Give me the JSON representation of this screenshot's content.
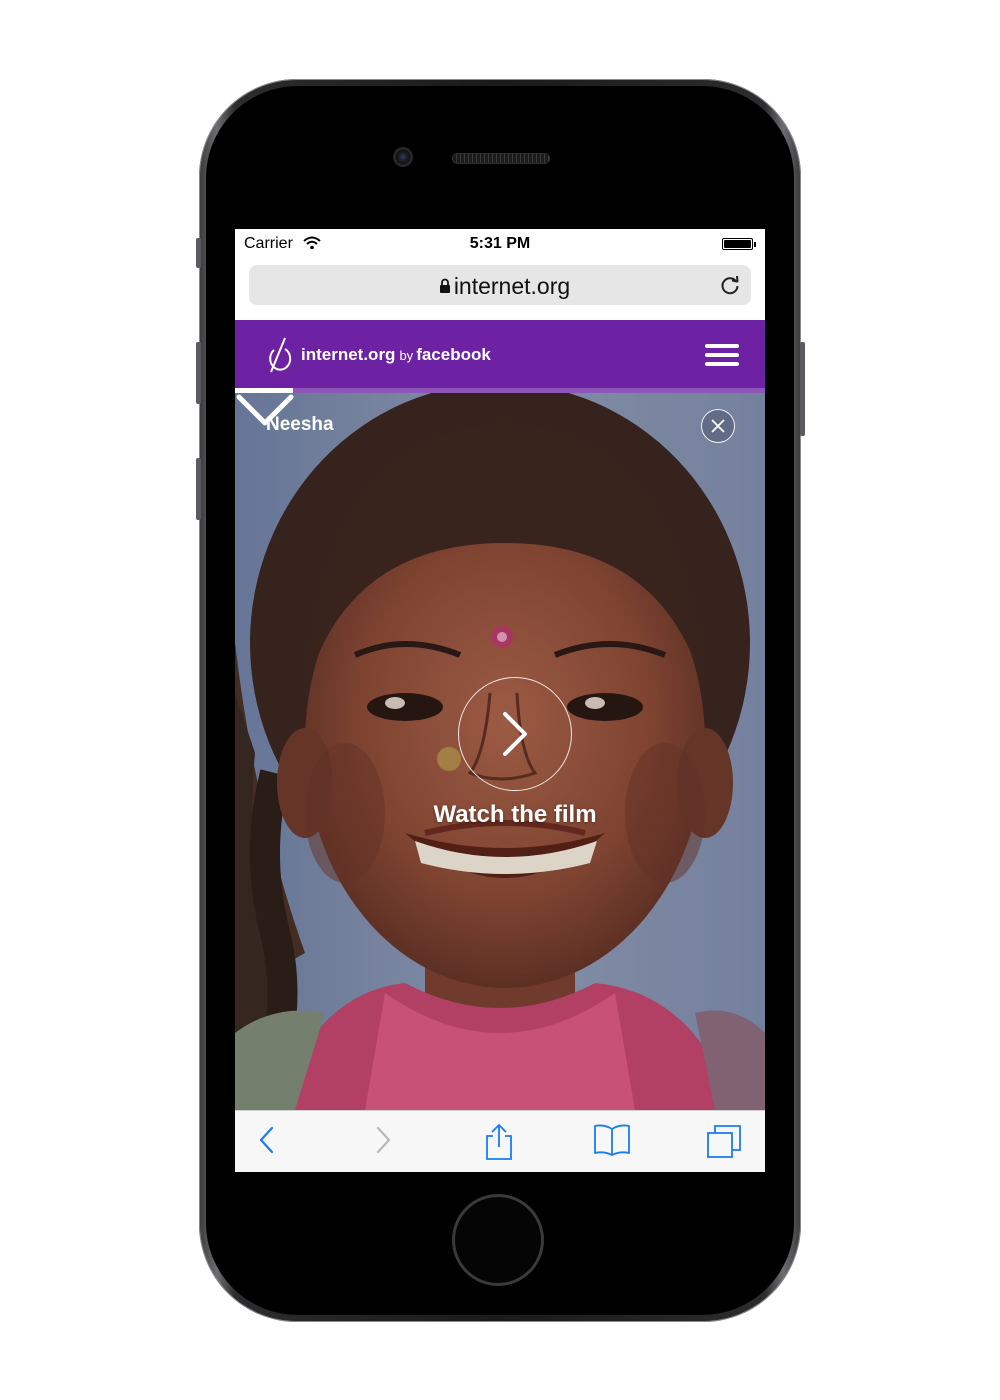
{
  "status_bar": {
    "carrier": "Carrier",
    "time": "5:31 PM",
    "wifi_icon": "wifi-icon",
    "battery_icon": "battery-icon"
  },
  "address_bar": {
    "url": "internet.org",
    "lock_icon": "lock-icon",
    "reload_icon": "reload-icon"
  },
  "site_header": {
    "logo_name": "internet.org",
    "logo_by": "by",
    "logo_company": "facebook",
    "menu_icon": "hamburger-menu-icon",
    "background_color": "#6c22a3",
    "progress_fraction": 0.11
  },
  "hero": {
    "person_name": "Neesha",
    "cta_label": "Watch the film",
    "play_icon": "chevron-right-icon",
    "close_icon": "close-icon",
    "scroll_icon": "chevron-down-icon"
  },
  "toolbar": {
    "back_icon": "back-icon",
    "forward_icon": "forward-icon",
    "share_icon": "share-icon",
    "bookmarks_icon": "bookmarks-icon",
    "tabs_icon": "tabs-icon",
    "accent_color": "#1a7cf0"
  }
}
